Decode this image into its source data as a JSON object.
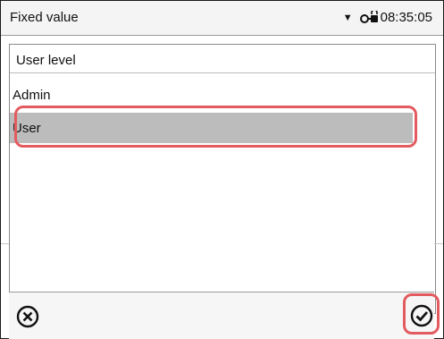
{
  "header": {
    "title": "Fixed value",
    "time": "08:35:05",
    "caret_icon": "dropdown-arrow-icon",
    "lock_icon": "key-lock-icon"
  },
  "dialog": {
    "title": "User level",
    "options": [
      "Admin",
      "User"
    ],
    "selected": "User"
  },
  "footer": {
    "cancel_icon": "cancel-circle-x-icon",
    "confirm_icon": "confirm-check-icon"
  },
  "colors": {
    "highlight": "#e35b5f",
    "selection": "#bcbcbc"
  }
}
